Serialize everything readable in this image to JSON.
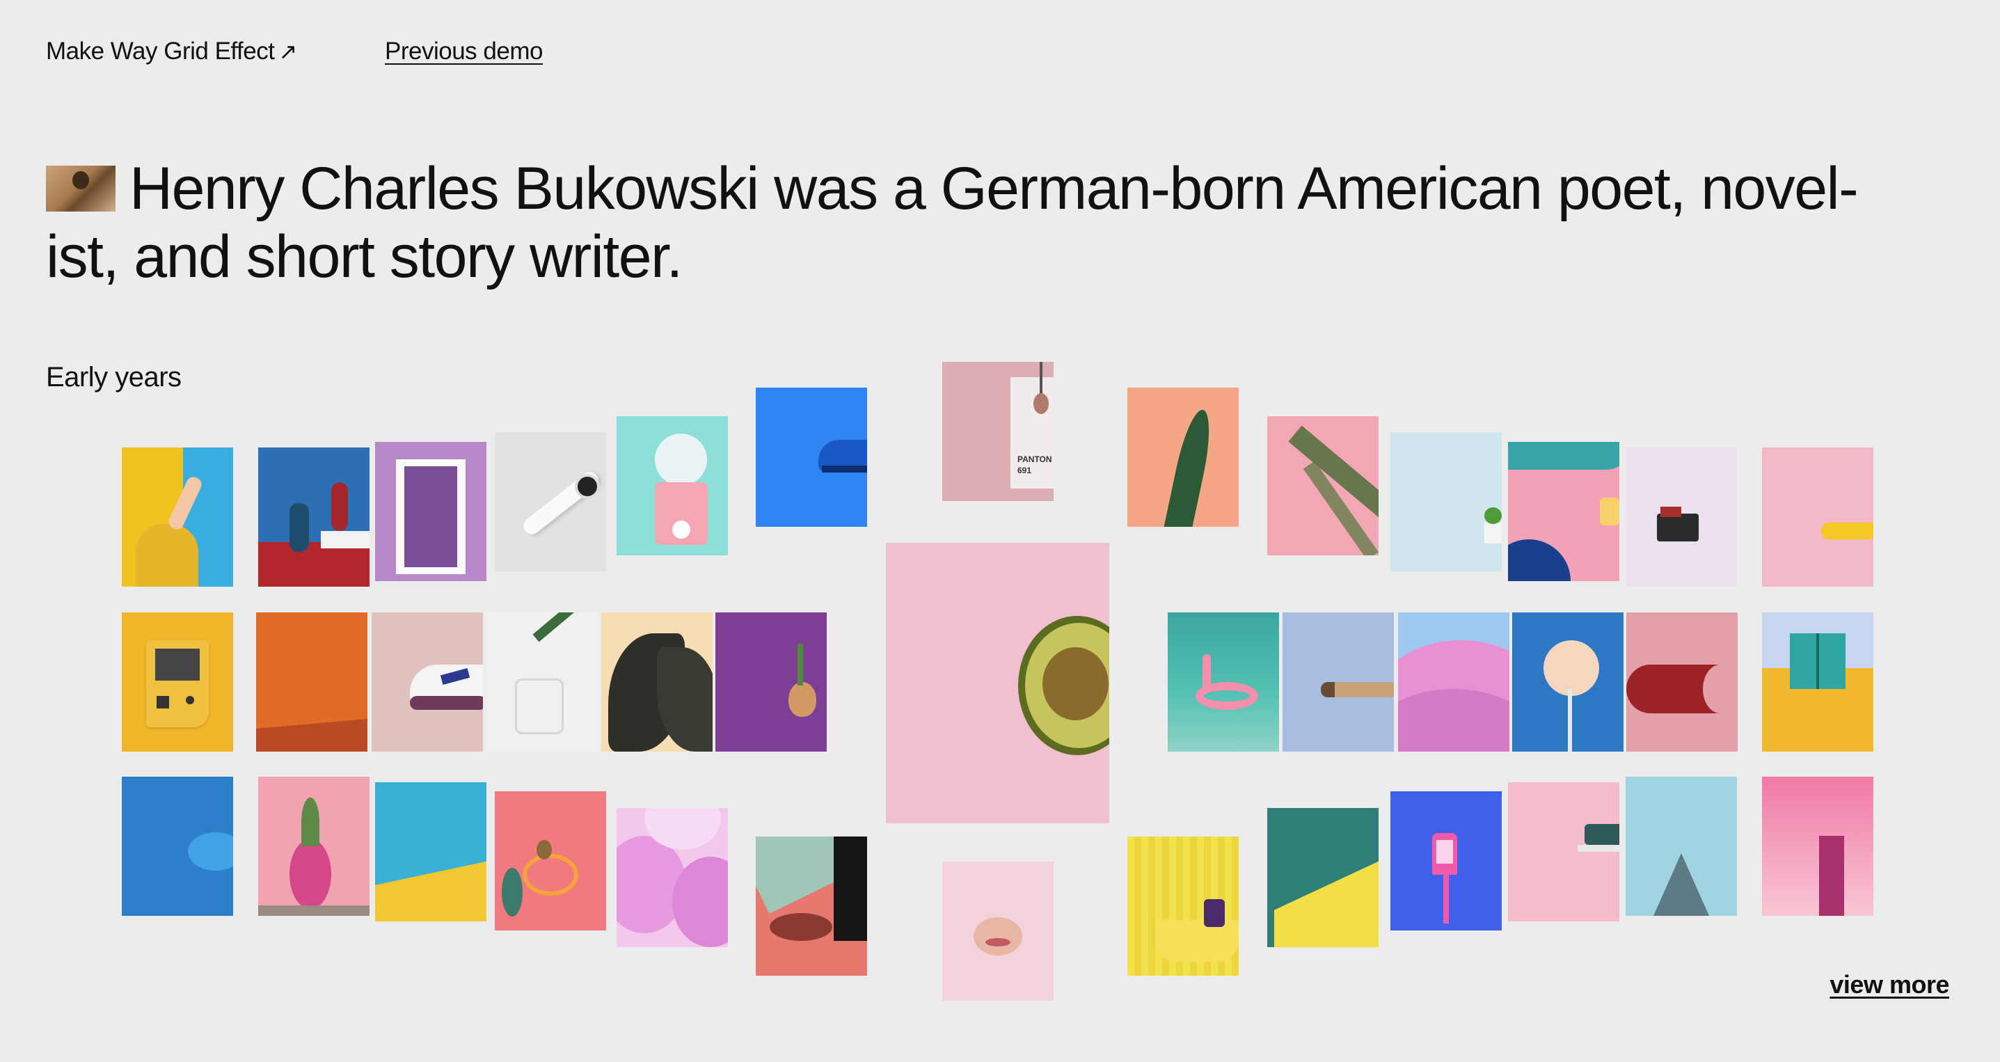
{
  "nav": {
    "title_link": "Make Way Grid Effect",
    "title_arrow": "↗",
    "previous_demo": "Previous demo"
  },
  "headline": {
    "line1": "Henry Charles Bukowski was a German-born American poet, novel-",
    "line2": "ist, and short story writer."
  },
  "section_label": "Early years",
  "view_more": "view more",
  "pantone": {
    "brand": "PANTON",
    "code": "691"
  },
  "colors": {
    "background": "#ececec",
    "text": "#111111"
  },
  "grid_images": [
    "yellow-hand",
    "red-vases",
    "purple-window",
    "watch",
    "gumball-machine",
    "blue-sneaker",
    "pantone-spoon",
    "green-plant",
    "palm-leaf",
    "small-plant",
    "pink-wall",
    "camera-toy",
    "banana",
    "gameboy",
    "orange-room",
    "sneaker-pink",
    "glass-leaf",
    "dark-leaves",
    "egg-plant",
    "avocado",
    "flamingo-float",
    "cigar",
    "pink-hills",
    "white-rose",
    "red-shape",
    "teal-door",
    "blue-fruit",
    "pineapple",
    "yellow-blue",
    "orange-chair",
    "pink-balloons",
    "legs-shadow",
    "lips",
    "yellow-bath",
    "yellow-roof",
    "pink-lamp",
    "plate-stack",
    "roof-sky",
    "pink-building"
  ]
}
